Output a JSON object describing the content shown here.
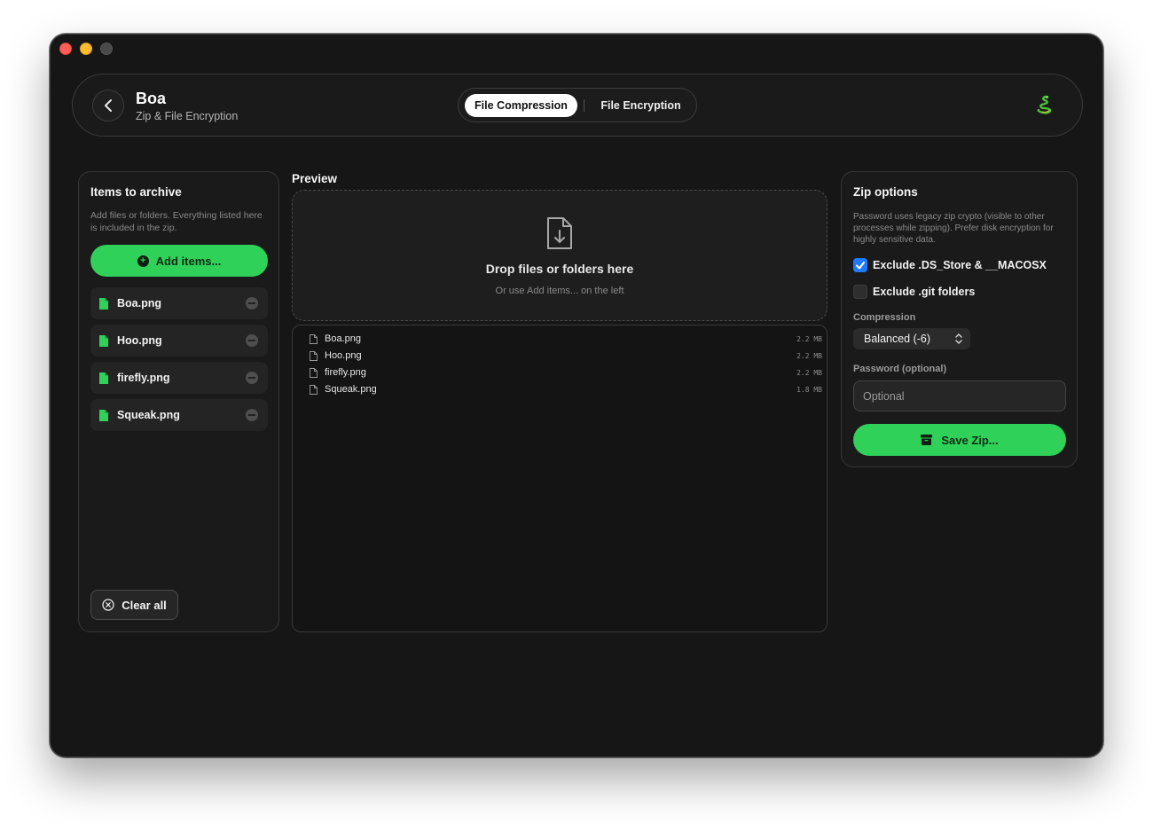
{
  "header": {
    "title": "Boa",
    "subtitle": "Zip & File Encryption",
    "tabs": [
      {
        "label": "File Compression",
        "active": true
      },
      {
        "label": "File Encryption",
        "active": false
      }
    ]
  },
  "left_panel": {
    "title": "Items to archive",
    "description": "Add files or folders. Everything listed here is included in the zip.",
    "add_label": "Add items...",
    "items": [
      "Boa.png",
      "Hoo.png",
      "firefly.png",
      "Squeak.png"
    ],
    "clear_label": "Clear all"
  },
  "preview": {
    "label": "Preview",
    "drop_title": "Drop files or folders here",
    "drop_subtitle": "Or use Add items... on the left",
    "files": [
      {
        "name": "Boa.png",
        "size": "2.2 MB"
      },
      {
        "name": "Hoo.png",
        "size": "2.2 MB"
      },
      {
        "name": "firefly.png",
        "size": "2.2 MB"
      },
      {
        "name": "Squeak.png",
        "size": "1.8 MB"
      }
    ]
  },
  "zip_options": {
    "title": "Zip options",
    "description": "Password uses legacy zip crypto (visible to other processes while zipping). Prefer disk encryption for highly sensitive data.",
    "exclude_ds_store": {
      "label": "Exclude .DS_Store & __MACOSX",
      "checked": true
    },
    "exclude_git": {
      "label": "Exclude .git folders",
      "checked": false
    },
    "compression_label": "Compression",
    "compression_value": "Balanced (-6)",
    "password_label": "Password (optional)",
    "password_placeholder": "Optional",
    "password_value": "",
    "save_label": "Save Zip..."
  },
  "colors": {
    "accent_green": "#2fd158",
    "checkbox_blue": "#1f7aff",
    "window_bg": "#161616"
  }
}
